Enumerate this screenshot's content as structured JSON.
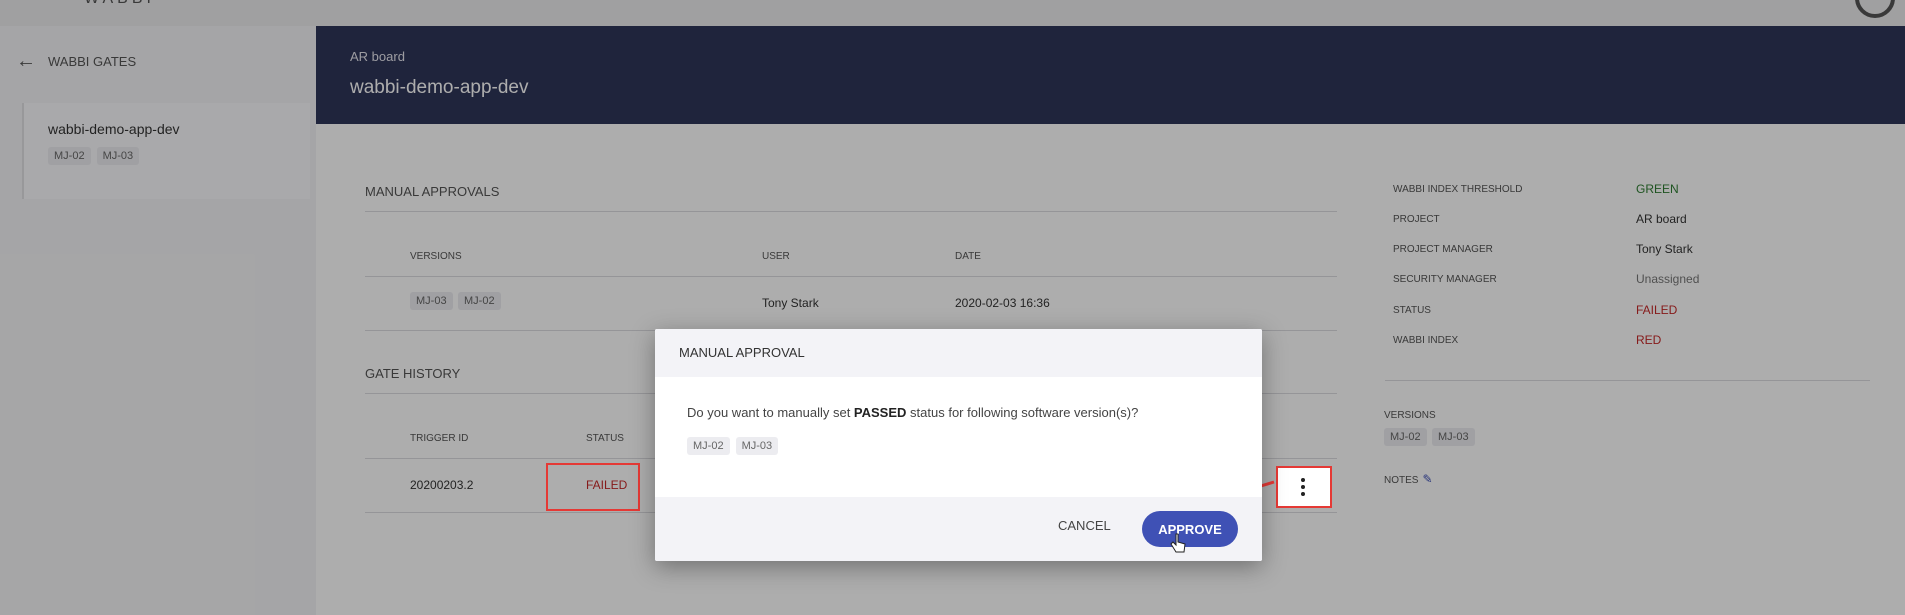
{
  "topbar": {
    "logo": "WABBI"
  },
  "sidebar": {
    "back_label": "WABBI GATES",
    "app": {
      "name": "wabbi-demo-app-dev",
      "tags": [
        "MJ-02",
        "MJ-03"
      ]
    }
  },
  "header": {
    "breadcrumb": "AR board",
    "title": "wabbi-demo-app-dev"
  },
  "manual_approvals": {
    "title": "MANUAL APPROVALS",
    "columns": {
      "versions": "VERSIONS",
      "user": "USER",
      "date": "DATE"
    },
    "row": {
      "versions": [
        "MJ-03",
        "MJ-02"
      ],
      "user": "Tony Stark",
      "date": "2020-02-03 16:36"
    }
  },
  "gate_history": {
    "title": "GATE HISTORY",
    "columns": {
      "trigger_id": "TRIGGER ID",
      "status": "STATUS"
    },
    "row": {
      "trigger_id": "20200203.2",
      "status": "FAILED"
    }
  },
  "details": {
    "threshold_label": "WABBI INDEX THRESHOLD",
    "threshold_value": "GREEN",
    "project_label": "PROJECT",
    "project_value": "AR board",
    "pm_label": "PROJECT MANAGER",
    "pm_value": "Tony Stark",
    "sm_label": "SECURITY MANAGER",
    "sm_value": "Unassigned",
    "status_label": "STATUS",
    "status_value": "FAILED",
    "index_label": "WABBI INDEX",
    "index_value": "RED",
    "versions_label": "VERSIONS",
    "versions": [
      "MJ-02",
      "MJ-03"
    ],
    "notes_label": "NOTES"
  },
  "dialog": {
    "title": "MANUAL APPROVAL",
    "question_pre": "Do you want to manually set ",
    "question_bold": "PASSED",
    "question_post": " status for following software version(s)?",
    "tags": [
      "MJ-02",
      "MJ-03"
    ],
    "cancel_label": "CANCEL",
    "approve_label": "APPROVE"
  },
  "colors": {
    "header_bg": "#2f3559",
    "accent": "#3f51b5",
    "failed": "#c62828",
    "green": "#2e7d32",
    "annotation": "#e53935"
  },
  "icons": [
    "arrow-left-icon",
    "more-vert-icon",
    "pencil-icon",
    "cursor-hand-icon"
  ]
}
